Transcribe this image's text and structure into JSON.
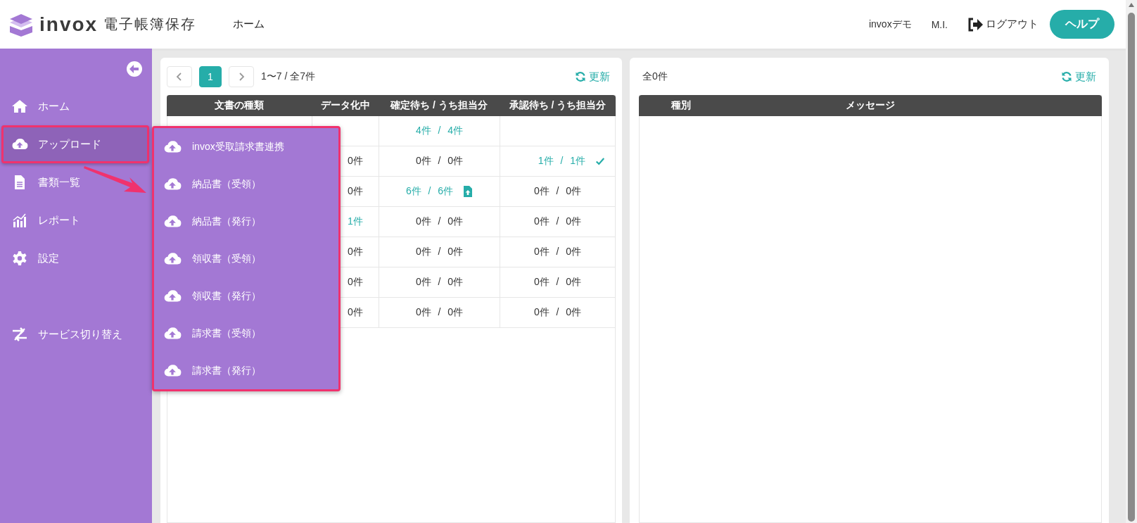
{
  "header": {
    "brand": "invox",
    "product": "電子帳簿保存",
    "nav": [
      {
        "label": "ホーム"
      }
    ],
    "company": "invoxデモ",
    "user": "M.I.",
    "logout": "ログアウト",
    "help": "ヘルプ"
  },
  "sidebar": {
    "items": [
      {
        "label": "ホーム",
        "kind": "home",
        "selected": false,
        "highlighted": false
      },
      {
        "label": "アップロード",
        "kind": "upload",
        "selected": true,
        "highlighted": true
      },
      {
        "label": "書類一覧",
        "kind": "file",
        "selected": false,
        "highlighted": false
      },
      {
        "label": "レポート",
        "kind": "chart",
        "selected": false,
        "highlighted": false
      },
      {
        "label": "設定",
        "kind": "gear",
        "selected": false,
        "highlighted": false
      }
    ],
    "footer_items": [
      {
        "label": "サービス切り替え",
        "kind": "switch",
        "selected": false,
        "highlighted": false
      }
    ]
  },
  "upload_menu": {
    "highlighted": true,
    "items": [
      {
        "label": "invox受取請求書連携"
      },
      {
        "label": "納品書（受領）"
      },
      {
        "label": "納品書（発行）"
      },
      {
        "label": "領収書（受領）"
      },
      {
        "label": "領収書（発行）"
      },
      {
        "label": "請求書（受領）"
      },
      {
        "label": "請求書（発行）"
      }
    ]
  },
  "callout_arrow": true,
  "documents": {
    "pager": {
      "pages": [
        {
          "label": "1",
          "selected": true
        }
      ],
      "range": "1〜7 / 全7件"
    },
    "refresh": "更新",
    "columns": [
      "文書の種類",
      "データ化中",
      "確定待ち / うち担当分",
      "承認待ち / うち担当分"
    ],
    "rows": [
      {
        "awaiting_confirmation": {
          "text": "4件 / 4件",
          "linked": true
        }
      },
      {
        "pending_data": {
          "text": "0件",
          "linked": false
        },
        "awaiting_confirmation": {
          "text": "0件 / 0件",
          "linked": false
        },
        "awaiting_approval": {
          "text": "1件 / 1件",
          "linked": true,
          "kind": "check"
        }
      },
      {
        "pending_data": {
          "text": "0件",
          "linked": false
        },
        "awaiting_confirmation": {
          "text": "6件 / 6件",
          "linked": true,
          "kind": "file-upload"
        },
        "awaiting_approval": {
          "text": "0件 / 0件",
          "linked": false
        }
      },
      {
        "pending_data": {
          "text": "1件",
          "linked": true
        },
        "awaiting_confirmation": {
          "text": "0件 / 0件",
          "linked": false
        },
        "awaiting_approval": {
          "text": "0件 / 0件",
          "linked": false
        }
      },
      {
        "pending_data": {
          "text": "0件",
          "linked": false
        },
        "awaiting_confirmation": {
          "text": "0件 / 0件",
          "linked": false
        },
        "awaiting_approval": {
          "text": "0件 / 0件",
          "linked": false
        }
      },
      {
        "pending_data": {
          "text": "0件",
          "linked": false
        },
        "awaiting_confirmation": {
          "text": "0件 / 0件",
          "linked": false
        },
        "awaiting_approval": {
          "text": "0件 / 0件",
          "linked": false
        }
      },
      {
        "pending_data": {
          "text": "0件",
          "linked": false
        },
        "awaiting_confirmation": {
          "text": "0件 / 0件",
          "linked": false
        },
        "awaiting_approval": {
          "text": "0件 / 0件",
          "linked": false
        }
      }
    ]
  },
  "notifications": {
    "count": "全0件",
    "refresh": "更新",
    "columns": [
      "種別",
      "メッセージ"
    ]
  }
}
